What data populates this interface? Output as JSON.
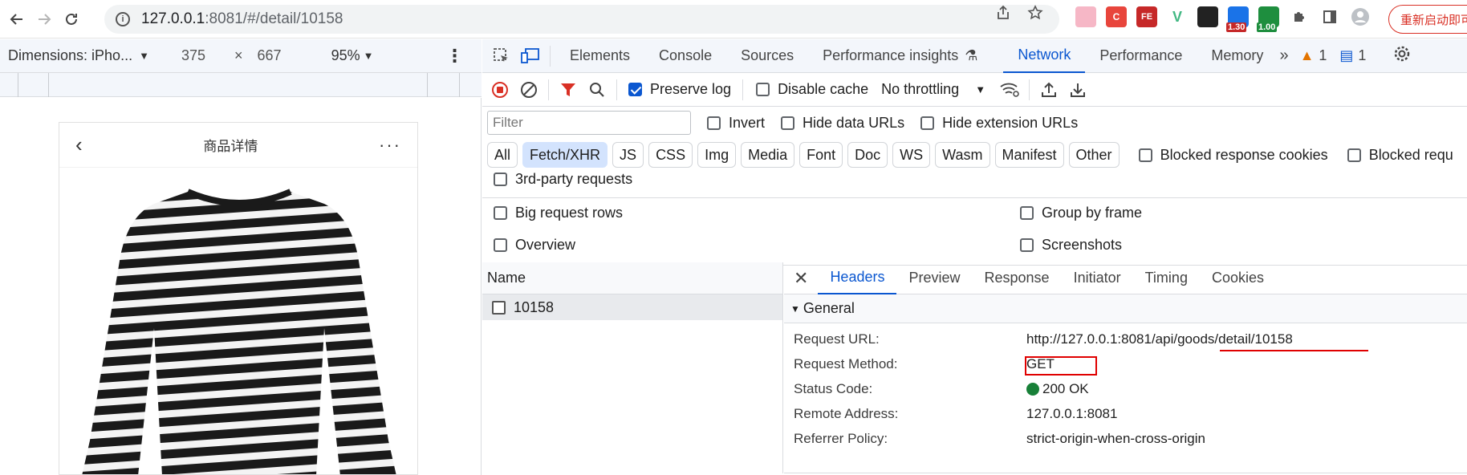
{
  "browser": {
    "url_host": "127.0.0.1",
    "url_path": ":8081/#/detail/10158",
    "restart_label": "重新启动即可",
    "extensions": [
      {
        "name": "ext-1",
        "label": "",
        "color": "#f6b7c6"
      },
      {
        "name": "ext-2",
        "label": "C",
        "color": "#e8453c"
      },
      {
        "name": "ext-3",
        "label": "FE",
        "color": "#c62828"
      },
      {
        "name": "ext-4",
        "label": "V",
        "color": "#42b883"
      },
      {
        "name": "ext-5",
        "label": "",
        "color": "#222222"
      },
      {
        "name": "ext-6",
        "label": "1.30",
        "color": "#1a73e8"
      },
      {
        "name": "ext-7",
        "label": "1.00",
        "color": "#1e8e3e"
      }
    ]
  },
  "device": {
    "dimensions_label": "Dimensions: iPho...",
    "width": "375",
    "times": "×",
    "height": "667",
    "zoom": "95%"
  },
  "phone": {
    "title": "商品详情",
    "back_glyph": "‹",
    "more_glyph": "···"
  },
  "devtools": {
    "tabs": [
      "Elements",
      "Console",
      "Sources",
      "Performance insights",
      "Network",
      "Performance",
      "Memory"
    ],
    "active_tab": "Network",
    "warning_count": "1",
    "message_count": "1",
    "toolbar": {
      "preserve_log": "Preserve log",
      "disable_cache": "Disable cache",
      "throttling": "No throttling"
    },
    "filter_placeholder": "Filter",
    "filter_options": [
      "Invert",
      "Hide data URLs",
      "Hide extension URLs"
    ],
    "types": [
      "All",
      "Fetch/XHR",
      "JS",
      "CSS",
      "Img",
      "Media",
      "Font",
      "Doc",
      "WS",
      "Wasm",
      "Manifest",
      "Other"
    ],
    "active_type": "Fetch/XHR",
    "blocked_response_cookies": "Blocked response cookies",
    "blocked_requests": "Blocked requ",
    "third_party": "3rd-party requests",
    "big_request_rows": "Big request rows",
    "group_by_frame": "Group by frame",
    "overview": "Overview",
    "screenshots": "Screenshots",
    "name_header": "Name",
    "request_name": "10158",
    "detail_tabs": [
      "Headers",
      "Preview",
      "Response",
      "Initiator",
      "Timing",
      "Cookies"
    ],
    "general_label": "General",
    "general": [
      {
        "key": "Request URL:",
        "value": "http://127.0.0.1:8081/api/goods/detail/10158"
      },
      {
        "key": "Request Method:",
        "value": "GET"
      },
      {
        "key": "Status Code:",
        "value": "200 OK"
      },
      {
        "key": "Remote Address:",
        "value": "127.0.0.1:8081"
      },
      {
        "key": "Referrer Policy:",
        "value": "strict-origin-when-cross-origin"
      }
    ],
    "status_color": "#188038",
    "accent": "#0b57d0",
    "annotation_color": "#e00000"
  }
}
